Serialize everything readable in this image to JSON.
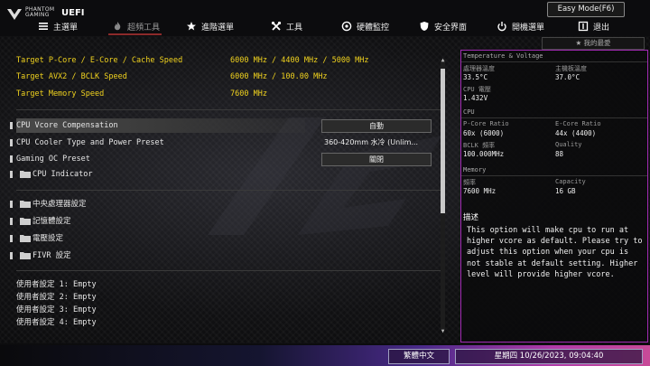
{
  "brand": {
    "line1": "PHANTOM",
    "line2": "GAMING",
    "uefi": "UEFI"
  },
  "easy_mode": "Easy Mode(F6)",
  "tabs": [
    {
      "label": "主選單",
      "icon": "list-icon"
    },
    {
      "label": "超頻工具",
      "icon": "flame-icon"
    },
    {
      "label": "進階選單",
      "icon": "star-icon"
    },
    {
      "label": "工具",
      "icon": "tools-icon"
    },
    {
      "label": "硬體監控",
      "icon": "monitor-icon"
    },
    {
      "label": "安全界面",
      "icon": "shield-icon"
    },
    {
      "label": "開機選單",
      "icon": "power-icon"
    },
    {
      "label": "退出",
      "icon": "exit-icon"
    }
  ],
  "favorites": "我的最愛",
  "targets": [
    {
      "label": "Target P-Core / E-Core / Cache Speed",
      "value": "6000 MHz / 4400 MHz / 5000 MHz"
    },
    {
      "label": "Target AVX2 / BCLK Speed",
      "value": "6000 MHz / 100.00 MHz"
    },
    {
      "label": "Target Memory Speed",
      "value": "7600 MHz"
    }
  ],
  "settings": [
    {
      "label": "CPU Vcore Compensation",
      "value": "自動"
    },
    {
      "label": "CPU Cooler Type and Power Preset",
      "value": "360-420mm 水冷 (Unlim..."
    },
    {
      "label": "Gaming OC Preset",
      "value": "關閉"
    },
    {
      "label": "CPU Indicator"
    }
  ],
  "folders": [
    "中央處理器設定",
    "記憶體設定",
    "電壓設定",
    "FIVR 設定"
  ],
  "user_settings": [
    "使用者設定 1: Empty",
    "使用者設定 2: Empty",
    "使用者設定 3: Empty",
    "使用者設定 4: Empty"
  ],
  "info": {
    "title": "Temperature & Voltage",
    "cpu_temp_label": "處理器溫度",
    "cpu_temp": "33.5°C",
    "mb_temp_label": "主機板溫度",
    "mb_temp": "37.0°C",
    "cpu_volt_label": "CPU 電壓",
    "cpu_volt": "1.432V",
    "cpu_title": "CPU",
    "pcore_label": "P-Core Ratio",
    "pcore": "60x (6000)",
    "ecore_label": "E-Core Ratio",
    "ecore": "44x (4400)",
    "bclk_label": "BCLK 頻率",
    "bclk": "100.000MHz",
    "quality_label": "Quality",
    "quality": "88",
    "mem_title": "Memory",
    "freq_label": "頻率",
    "freq": "7600 MHz",
    "cap_label": "Capacity",
    "cap": "16 GB"
  },
  "description": {
    "title": "描述",
    "text": "This option will make cpu to run at higher vcore as default. Please try to adjust this option when your cpu is not stable at default setting. Higher level will provide higher vcore."
  },
  "footer": {
    "language": "繁體中文",
    "datetime": "星期四 10/26/2023, 09:04:40"
  }
}
